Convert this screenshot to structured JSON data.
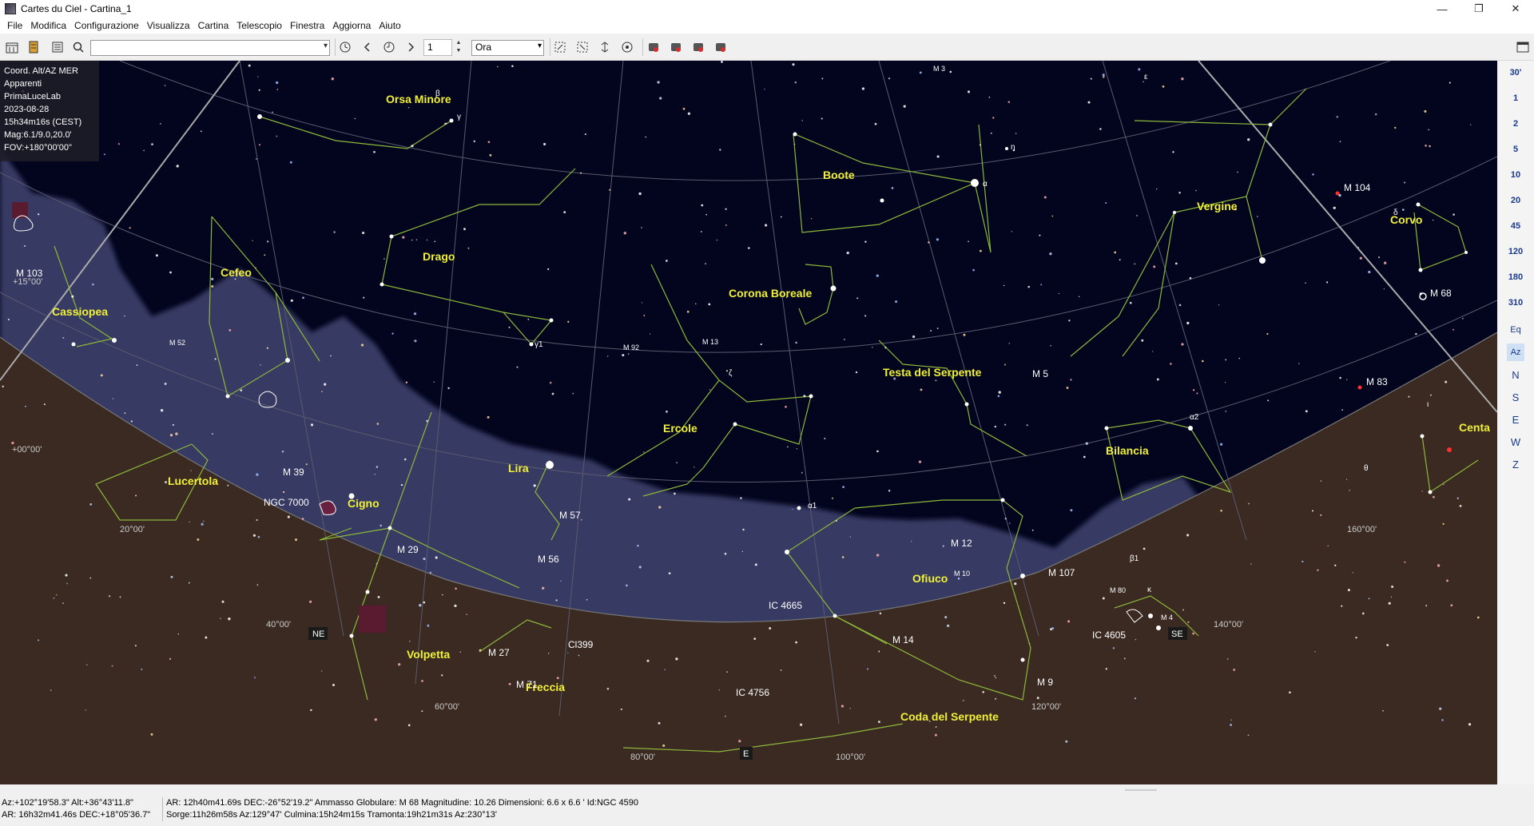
{
  "window": {
    "title": "Cartes du Ciel - Cartina_1",
    "minimize_glyph": "—",
    "maximize_glyph": "❐",
    "close_glyph": "✕"
  },
  "menu": [
    "File",
    "Modifica",
    "Configurazione",
    "Visualizza",
    "Cartina",
    "Telescopio",
    "Finestra",
    "Aggiorna",
    "Aiuto"
  ],
  "toolbar": {
    "search_value": "",
    "step_count": "1",
    "step_unit": "Ora"
  },
  "right_panel": {
    "fov_buttons": [
      "30'",
      "1",
      "2",
      "5",
      "10",
      "20",
      "45",
      "120",
      "180",
      "310"
    ],
    "tools": [
      "Eq",
      "Az",
      "N",
      "S",
      "E",
      "W",
      "Z"
    ]
  },
  "info_box": {
    "lines": [
      "Coord. Alt/AZ MER",
      "Apparenti",
      "PrimaLuceLab",
      "2023-08-28",
      "15h34m16s (CEST)",
      "Mag:6.1/9.0,20.0'",
      "FOV:+180°00'00\""
    ]
  },
  "sky": {
    "constellations": [
      "Orsa Minore",
      "Boote",
      "Vergine",
      "Corvo",
      "Drago",
      "Cefeo",
      "Cassiopea",
      "Corona Boreale",
      "Testa del Serpente",
      "Bilancia",
      "Ercole",
      "Lira",
      "Lucertola",
      "Cigno",
      "Ofiuco",
      "Volpetta",
      "Freccia",
      "Coda del Serpente",
      "Centa"
    ],
    "objects": [
      "M 3",
      "M 104",
      "M 68",
      "M 103",
      "M 52",
      "M 92",
      "M 13",
      "M 5",
      "M 83",
      "M 39",
      "NGC 7000",
      "M 57",
      "M 29",
      "M 56",
      "M 12",
      "M 10",
      "M 107",
      "M 80",
      "M 4",
      "IC 4605",
      "IC 4665",
      "M 14",
      "M 27",
      "Cl399",
      "M 71",
      "IC 4756",
      "M 9"
    ],
    "greek": [
      "β",
      "γ",
      "ε",
      "η",
      "α",
      "δ",
      "ζ",
      "θ",
      "ι",
      "κ",
      "α1",
      "α2",
      "β1",
      "γ1"
    ],
    "grid_labels": [
      "+15°00'",
      "+00°00'",
      "20°00'",
      "40°00'",
      "60°00'",
      "80°00'",
      "100°00'",
      "120°00'",
      "140°00'",
      "160°00'"
    ],
    "horizon_points": [
      "NE",
      "E",
      "SE"
    ]
  },
  "status": {
    "coord_line1": "Az:+102°19'58.3\" Alt:+36°43'11.8\"",
    "coord_line2": "AR: 16h32m41.46s DEC:+18°05'36.7\"",
    "object_line1": "AR: 12h40m41.69s DEC:-26°52'19.2\"  Ammasso Globulare: M 68  Magnitudine: 10.26  Dimensioni:   6.6 x  6.6 '  Id:NGC 4590",
    "object_line2": "Sorge:11h26m58s Az:129°47'  Culmina:15h24m15s  Tramonta:19h21m31s Az:230°13'"
  },
  "colors": {
    "sky": "#02051d",
    "milky_way": "#3a3f66",
    "ground": "#3a2a22",
    "constellation_line": "#8cb83a",
    "label": "#f1f038",
    "grid": "#6a6a7a",
    "object_label": "#ffffff"
  }
}
